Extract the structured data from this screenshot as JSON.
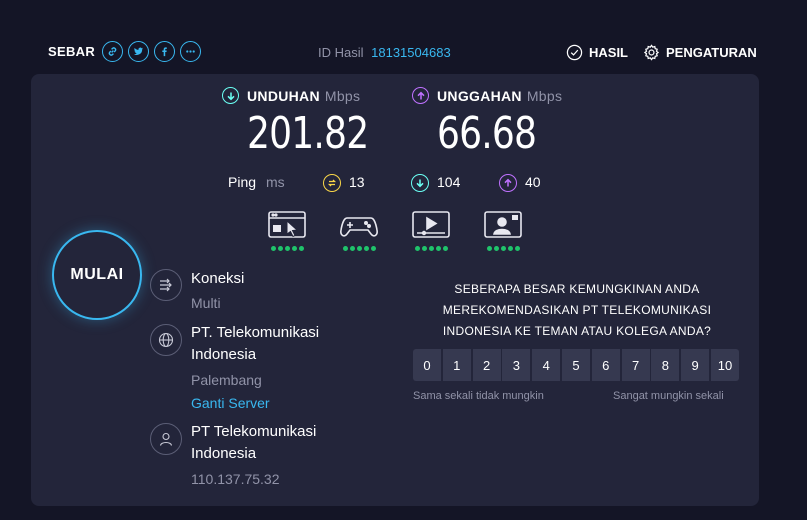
{
  "header": {
    "share_label": "SEBAR",
    "share_icons": [
      "link-icon",
      "twitter-icon",
      "facebook-icon",
      "more-icon"
    ],
    "result_id_label": "ID Hasil",
    "result_id_value": "18131504683",
    "results_label": "HASIL",
    "settings_label": "PENGATURAN"
  },
  "download": {
    "label": "UNDUHAN",
    "unit": "Mbps",
    "value": "201.82",
    "color": "#6afff3"
  },
  "upload": {
    "label": "UNGGAHAN",
    "unit": "Mbps",
    "value": "66.68",
    "color": "#bf71ff"
  },
  "ping": {
    "label": "Ping",
    "unit": "ms",
    "idle": "13",
    "download": "104",
    "upload": "40",
    "idle_color": "#f9d648"
  },
  "quality_icons": [
    {
      "name": "browsing-icon",
      "rating": 5
    },
    {
      "name": "gaming-icon",
      "rating": 5
    },
    {
      "name": "video-streaming-icon",
      "rating": 5
    },
    {
      "name": "video-call-icon",
      "rating": 5
    }
  ],
  "go_button": {
    "label": "MULAI",
    "accent": "#39b8f0"
  },
  "connection": {
    "title": "Koneksi",
    "value": "Multi"
  },
  "server": {
    "name_line1": "PT. Telekomunikasi",
    "name_line2": "Indonesia",
    "location": "Palembang",
    "change_link": "Ganti Server"
  },
  "provider": {
    "name_line1": "PT Telekomunikasi",
    "name_line2": "Indonesia",
    "ip": "110.137.75.32"
  },
  "survey": {
    "line1": "SEBERAPA BESAR KEMUNGKINAN ANDA",
    "line2": "MEREKOMENDASIKAN PT TELEKOMUNIKASI",
    "line3": "INDONESIA KE TEMAN ATAU KOLEGA ANDA?",
    "scale": [
      "0",
      "1",
      "2",
      "3",
      "4",
      "5",
      "6",
      "7",
      "8",
      "9",
      "10"
    ],
    "low_label": "Sama sekali tidak mungkin",
    "high_label": "Sangat mungkin sekali"
  },
  "colors": {
    "background": "#141526",
    "panel": "#23253a",
    "good": "#1fc46b"
  }
}
